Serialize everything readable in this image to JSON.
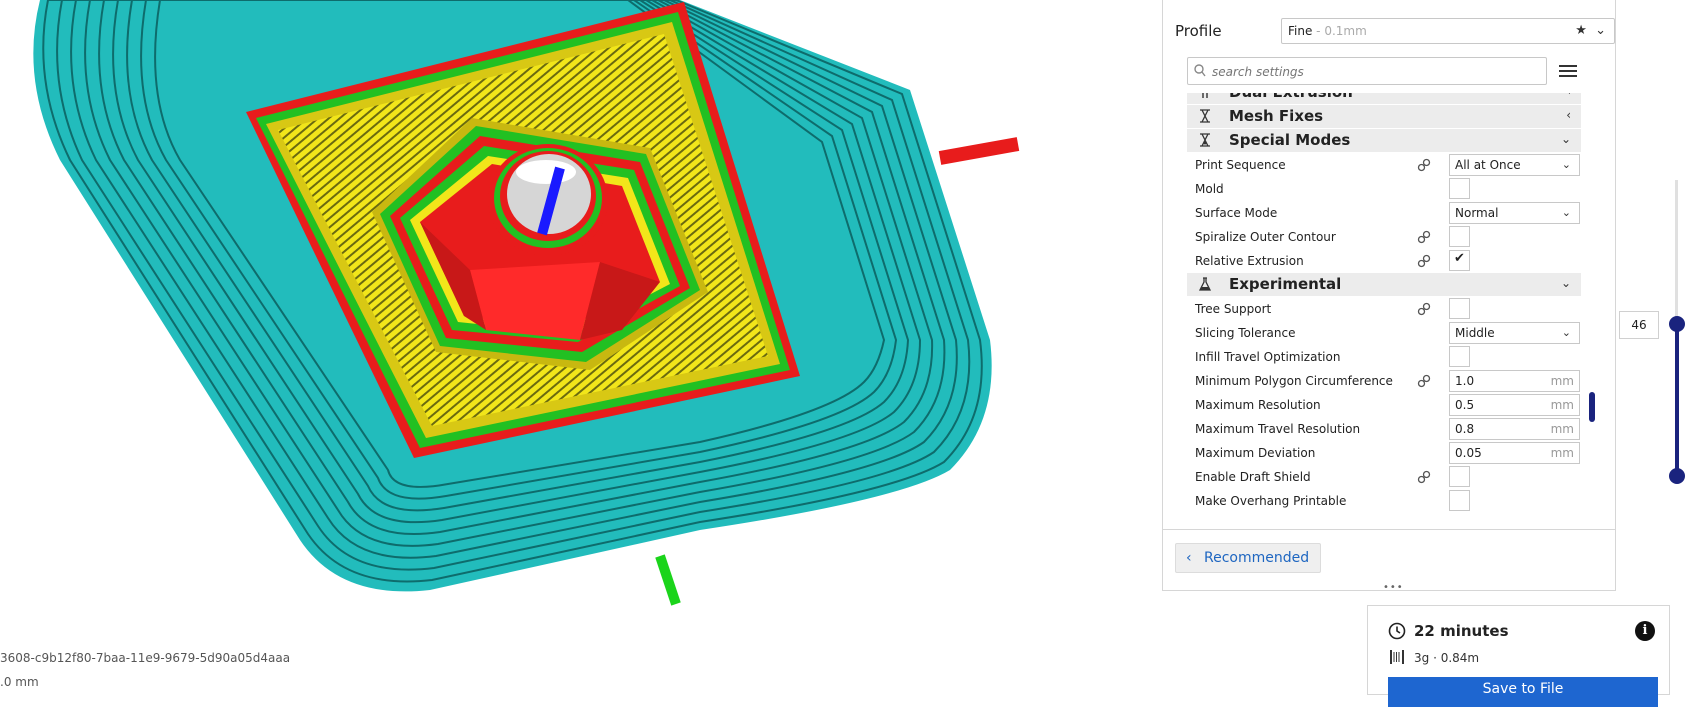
{
  "viewport": {
    "object_id": "3608-c9b12f80-7baa-11e9-9679-5d90a05d4aaa",
    "dimension": ".0 mm"
  },
  "panel": {
    "profile_label": "Profile",
    "profile_value": "Fine",
    "profile_suffix": " - 0.1mm",
    "search_placeholder": "search settings",
    "categories": {
      "dual_extrusion": "Dual Extrusion",
      "mesh_fixes": "Mesh Fixes",
      "special_modes": "Special Modes",
      "experimental": "Experimental"
    },
    "settings": {
      "print_sequence": {
        "label": "Print Sequence",
        "value": "All at Once"
      },
      "mold": {
        "label": "Mold"
      },
      "surface_mode": {
        "label": "Surface Mode",
        "value": "Normal"
      },
      "spiralize": {
        "label": "Spiralize Outer Contour"
      },
      "relative_extrusion": {
        "label": "Relative Extrusion",
        "checked": true
      },
      "tree_support": {
        "label": "Tree Support"
      },
      "slicing_tolerance": {
        "label": "Slicing Tolerance",
        "value": "Middle"
      },
      "infill_travel": {
        "label": "Infill Travel Optimization"
      },
      "min_polygon": {
        "label": "Minimum Polygon Circumference",
        "value": "1.0",
        "unit": "mm"
      },
      "max_resolution": {
        "label": "Maximum Resolution",
        "value": "0.5",
        "unit": "mm"
      },
      "max_travel_resolution": {
        "label": "Maximum Travel Resolution",
        "value": "0.8",
        "unit": "mm"
      },
      "max_deviation": {
        "label": "Maximum Deviation",
        "value": "0.05",
        "unit": "mm"
      },
      "draft_shield": {
        "label": "Enable Draft Shield"
      },
      "overhang_printable": {
        "label": "Make Overhang Printable"
      }
    },
    "recommended_label": "Recommended"
  },
  "layer_slider": {
    "current_layer": "46"
  },
  "print_info": {
    "time": "22 minutes",
    "material": "3g · 0.84m",
    "save_label": "Save to File"
  },
  "colors": {
    "outer_wall": "#2ad4d4",
    "inner_wall": "#22c022",
    "skin": "#f2e61a",
    "wall_red": "#e81c1c",
    "accent": "#1e66d0",
    "slider": "#1a237e"
  }
}
